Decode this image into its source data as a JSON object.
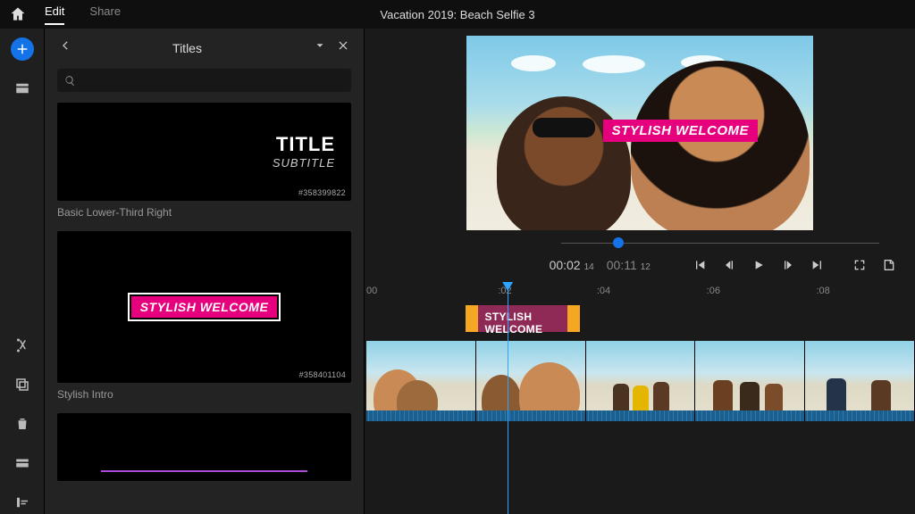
{
  "topbar": {
    "tabs": {
      "edit": "Edit",
      "share": "Share"
    },
    "project_title": "Vacation 2019: Beach Selfie 3"
  },
  "panel": {
    "title": "Titles",
    "search_placeholder": "",
    "cards": [
      {
        "title_line1": "TITLE",
        "title_line2": "SUBTITLE",
        "asset_id": "#358399822",
        "label": "Basic Lower-Third Right"
      },
      {
        "tag": "STYLISH WELCOME",
        "asset_id": "#358401104",
        "label": "Stylish Intro"
      },
      {
        "label": ""
      }
    ]
  },
  "monitor": {
    "overlay_text": "STYLISH WELCOME"
  },
  "transport": {
    "current_tc": "00:02",
    "current_frames": "14",
    "duration_tc": "00:11",
    "duration_frames": "12"
  },
  "timeline": {
    "ticks": [
      "00",
      ":02",
      ":04",
      ":06",
      ":08"
    ],
    "tick_positions_pct": [
      0,
      24,
      42,
      62,
      82
    ],
    "playhead_pct": 26,
    "title_clip": {
      "text": "STYLISH WELCOME",
      "left_pct": 18,
      "width_pct": 21
    }
  },
  "colors": {
    "accent": "#1473e6",
    "magenta": "#e6007e",
    "orange": "#f5a623"
  }
}
